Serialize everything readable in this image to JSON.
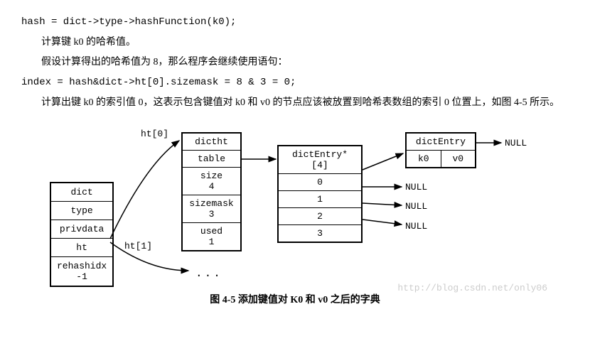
{
  "code1": "hash = dict->type->hashFunction(k0);",
  "para1": "计算键 k0 的哈希值。",
  "para2": "假设计算得出的哈希值为 8，那么程序会继续使用语句：",
  "code2": "index = hash&dict->ht[0].sizemask = 8 & 3 = 0;",
  "para3": "计算出键 k0 的索引值 0，这表示包含键值对 k0 和 v0 的节点应该被放置到哈希表数组的索引 0 位置上，如图 4-5 所示。",
  "labels": {
    "ht0": "ht[0]",
    "ht1": "ht[1]",
    "dots": "..."
  },
  "dict": {
    "r0": "dict",
    "r1": "type",
    "r2": "privdata",
    "r3": "ht",
    "r4_label": "rehashidx",
    "r4_val": "-1"
  },
  "dictht": {
    "r0": "dictht",
    "r1": "table",
    "r2_label": "size",
    "r2_val": "4",
    "r3_label": "sizemask",
    "r3_val": "3",
    "r4_label": "used",
    "r4_val": "1"
  },
  "arr": {
    "header": "dictEntry*[4]",
    "i0": "0",
    "i1": "1",
    "i2": "2",
    "i3": "3"
  },
  "entry": {
    "header": "dictEntry",
    "k": "k0",
    "v": "v0"
  },
  "nulls": {
    "n0": "NULL",
    "n1": "NULL",
    "n2": "NULL",
    "n3": "NULL"
  },
  "caption": "图 4-5  添加键值对 K0 和 v0 之后的字典",
  "watermark": "http://blog.csdn.net/only06"
}
